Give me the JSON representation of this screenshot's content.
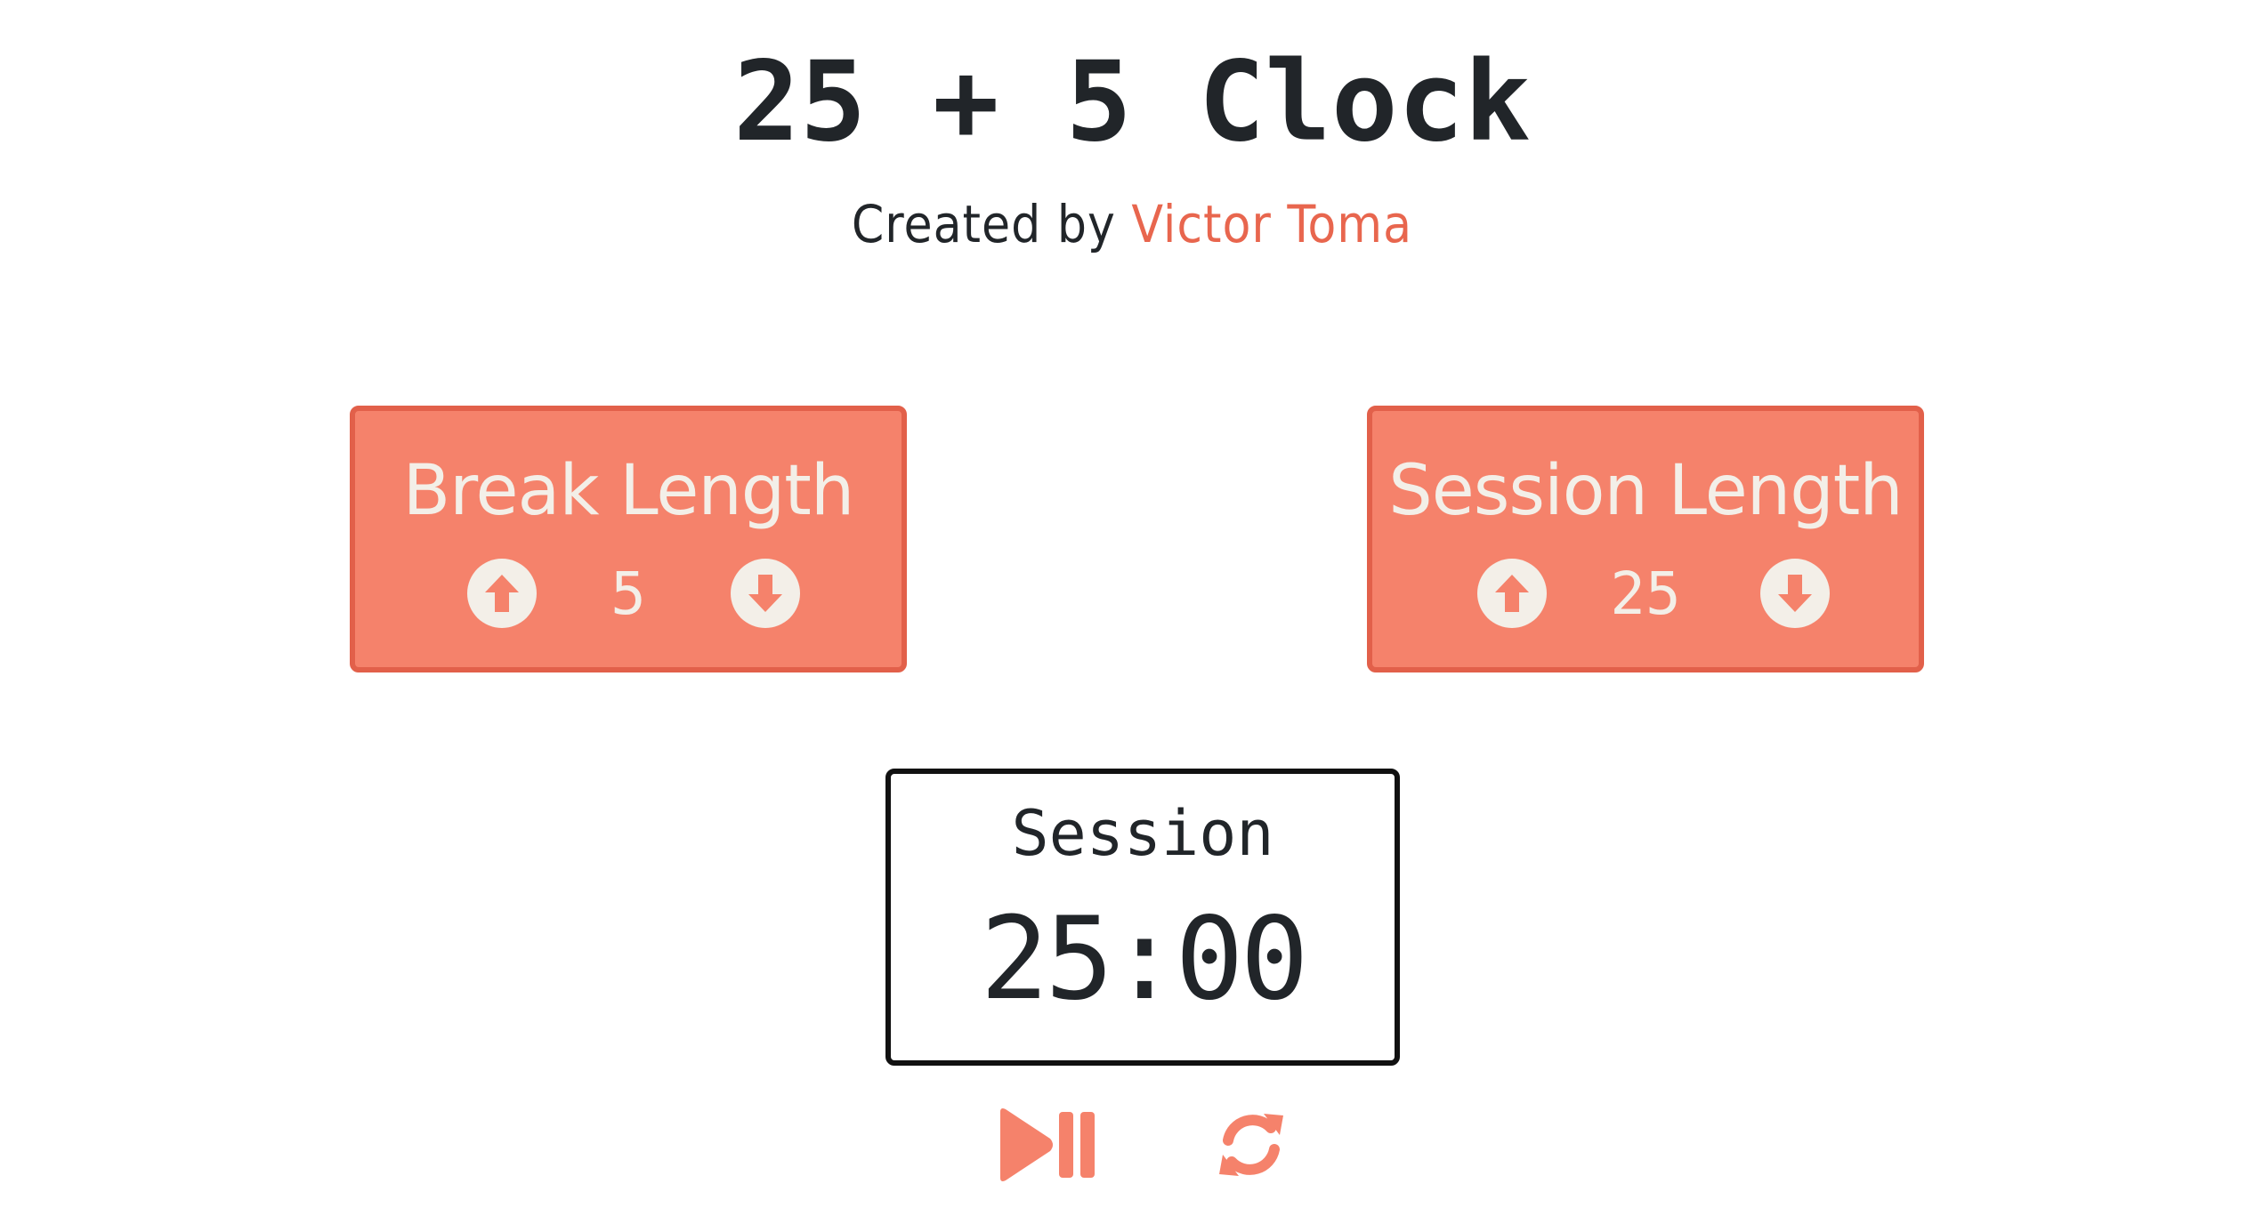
{
  "header": {
    "title": "25 + 5 Clock",
    "created_by": "Created by",
    "author": "Victor Toma"
  },
  "break": {
    "label": "Break Length",
    "value": "5",
    "increment_icon": "arrow-circle-up-icon",
    "decrement_icon": "arrow-circle-down-icon"
  },
  "session": {
    "label": "Session Length",
    "value": "25",
    "increment_icon": "arrow-circle-up-icon",
    "decrement_icon": "arrow-circle-down-icon"
  },
  "timer": {
    "label": "Session",
    "time_left": "25:00"
  },
  "actions": {
    "start_stop_icon": "play-pause-icon",
    "reset_icon": "refresh-icon"
  },
  "colors": {
    "accent": "#f5826b",
    "accent_border": "#e2604a",
    "author": "#e8664e",
    "box_text": "#f3efe8",
    "text": "#212529"
  }
}
